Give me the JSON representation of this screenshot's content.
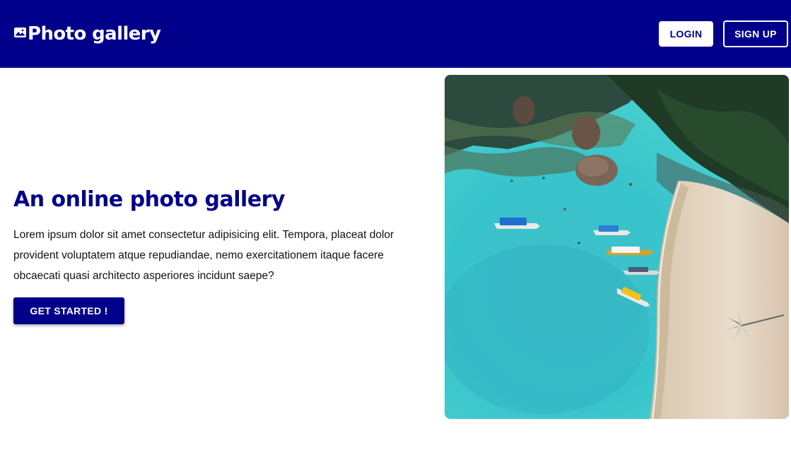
{
  "navbar": {
    "brand_icon": "landscape-photo-icon",
    "brand_title": "Photo gallery",
    "login_label": "LOGIN",
    "signup_label": "SIGN UP"
  },
  "hero": {
    "title": "An online photo gallery",
    "body": "Lorem ipsum dolor sit amet consectetur adipisicing elit. Tempora, placeat dolor provident voluptatem atque repudiandae, nemo exercitationem itaque facere obcaecati quasi architecto asperiores incidunt saepe?",
    "cta_label": "GET STARTED !",
    "image": "aerial-beach-boats-photo"
  },
  "colors": {
    "primary": "#00008b",
    "background": "#ffffff",
    "text": "#111111"
  }
}
